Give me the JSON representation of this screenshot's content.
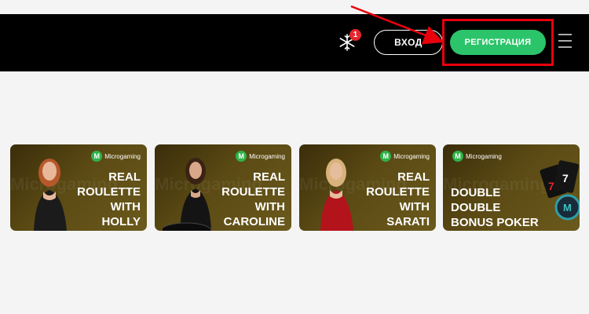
{
  "header": {
    "notification_count": "1",
    "login_label": "ВХОД",
    "register_label": "РЕГИСТРАЦИЯ"
  },
  "games": [
    {
      "provider": "Microgaming",
      "logo_letter": "M",
      "title_lines": [
        "REAL",
        "ROULETTE",
        "WITH",
        "HOLLY"
      ],
      "watermark": "Microgaming"
    },
    {
      "provider": "Microgaming",
      "logo_letter": "M",
      "title_lines": [
        "REAL",
        "ROULETTE",
        "WITH",
        "CAROLINE"
      ],
      "watermark": "Microgaming"
    },
    {
      "provider": "Microgaming",
      "logo_letter": "M",
      "title_lines": [
        "REAL",
        "ROULETTE",
        "WITH",
        "SARATI"
      ],
      "watermark": "Microgaming"
    },
    {
      "provider": "Microgaming",
      "logo_letter": "M",
      "title_lines": [
        "DOUBLE",
        "DOUBLE",
        "BONUS POKER"
      ],
      "watermark": "Microgaming"
    }
  ],
  "colors": {
    "header_bg": "#000000",
    "register_bg": "#2cc46a",
    "highlight": "#e8000c",
    "badge": "#e5262e"
  }
}
